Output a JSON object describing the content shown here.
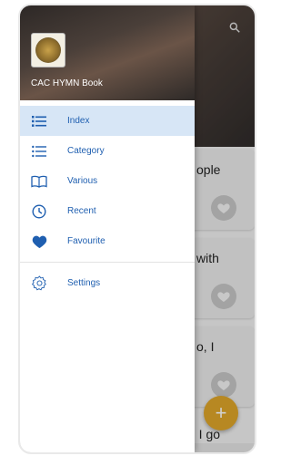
{
  "drawer": {
    "app_title": "CAC HYMN Book",
    "items": [
      {
        "label": "Index",
        "icon": "list-icon",
        "active": true
      },
      {
        "label": "Category",
        "icon": "bullet-list-icon",
        "active": false
      },
      {
        "label": "Various",
        "icon": "book-icon",
        "active": false
      },
      {
        "label": "Recent",
        "icon": "clock-icon",
        "active": false
      },
      {
        "label": "Favourite",
        "icon": "heart-icon",
        "active": false
      }
    ],
    "settings": {
      "label": "Settings",
      "icon": "gear-icon"
    }
  },
  "background": {
    "cards": [
      {
        "text": "ople"
      },
      {
        "text": "with"
      },
      {
        "text": "o, I"
      }
    ],
    "last_text": "d I go",
    "fab_label": "+"
  },
  "colors": {
    "accent": "#1f5fb0",
    "active_bg": "#d7e6f6",
    "fab": "#e0a72a"
  }
}
